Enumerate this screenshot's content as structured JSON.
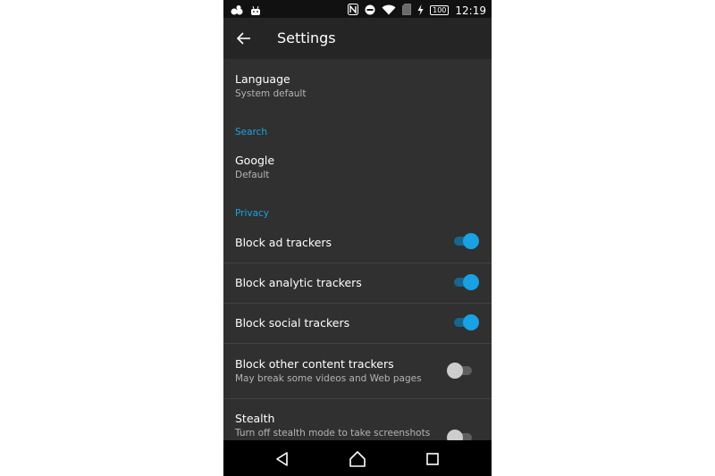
{
  "status_bar": {
    "battery_level": "100",
    "time": "12:19"
  },
  "toolbar": {
    "title": "Settings"
  },
  "settings": {
    "language": {
      "title": "Language",
      "subtitle": "System default"
    },
    "search_header": "Search",
    "search_engine": {
      "title": "Google",
      "subtitle": "Default"
    },
    "privacy_header": "Privacy",
    "block_ad_trackers": {
      "title": "Block ad trackers",
      "enabled": true
    },
    "block_analytic_trackers": {
      "title": "Block analytic trackers",
      "enabled": true
    },
    "block_social_trackers": {
      "title": "Block social trackers",
      "enabled": true
    },
    "block_other_trackers": {
      "title": "Block other content trackers",
      "subtitle": "May break some videos and Web pages",
      "enabled": false
    },
    "stealth": {
      "title": "Stealth",
      "subtitle": "Turn off stealth mode to take screenshots",
      "enabled": false
    }
  },
  "colors": {
    "accent": "#1aa4e4",
    "background": "#303030",
    "toolbar": "#252525"
  }
}
